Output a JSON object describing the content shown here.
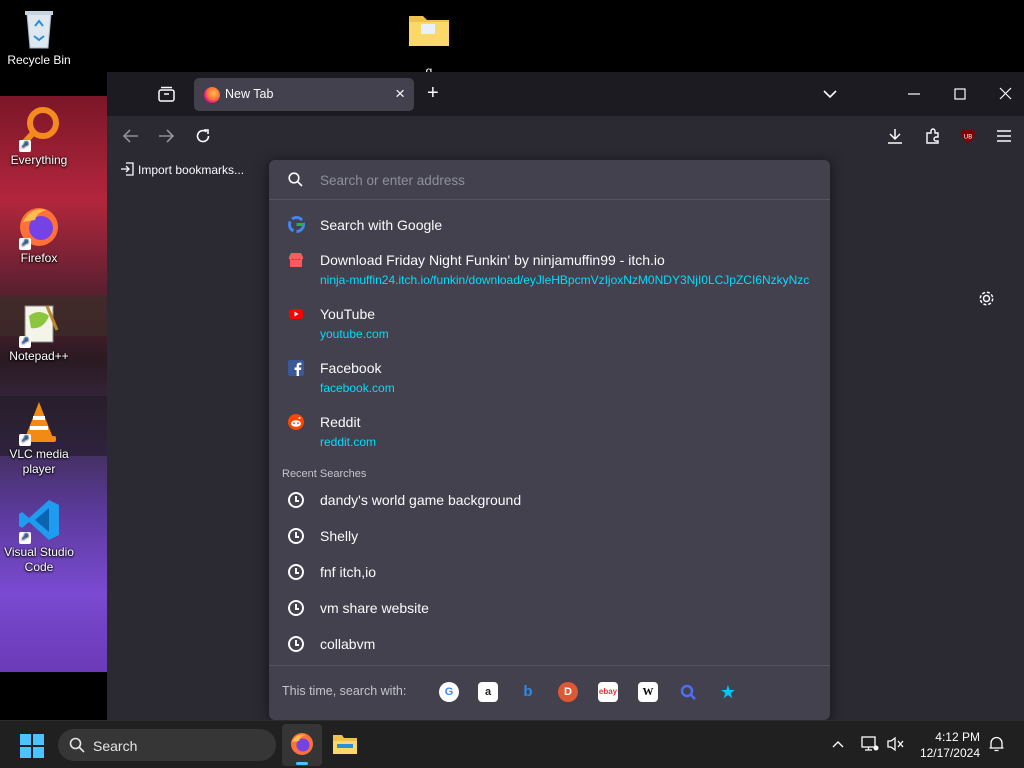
{
  "desktop": {
    "icons": [
      {
        "label": "Recycle Bin"
      },
      {
        "label": "g"
      },
      {
        "label": "Everything"
      },
      {
        "label": "Firefox"
      },
      {
        "label": "Notepad++"
      },
      {
        "label": "VLC media player"
      },
      {
        "label": "Visual Studio Code"
      }
    ]
  },
  "browser": {
    "tab_title": "New Tab",
    "bookmark_import": "Import bookmarks...",
    "address_placeholder": "Search or enter address"
  },
  "suggestions": [
    {
      "title": "Search with Google",
      "url": "",
      "icon": "google-icon"
    },
    {
      "title": "Download Friday Night Funkin' by ninjamuffin99 - itch.io",
      "url": "ninja-muffin24.itch.io/funkin/download/eyJleHBpcmVzIjoxNzM0NDY3NjI0LCJpZCI6NzkyNzc",
      "icon": "itch-icon"
    },
    {
      "title": "YouTube",
      "url": "youtube.com",
      "icon": "youtube-icon"
    },
    {
      "title": "Facebook",
      "url": "facebook.com",
      "icon": "facebook-icon"
    },
    {
      "title": "Reddit",
      "url": "reddit.com",
      "icon": "reddit-icon"
    }
  ],
  "recent": {
    "header": "Recent Searches",
    "items": [
      "dandy's world game background",
      "Shelly",
      "fnf itch,io",
      "vm share website",
      "collabvm"
    ]
  },
  "footer": {
    "label": "This time, search with:",
    "engines": [
      "google",
      "amazon",
      "bing",
      "duckduckgo",
      "ebay",
      "wikipedia",
      "search",
      "bookmarks"
    ]
  },
  "taskbar": {
    "search_label": "Search",
    "time": "4:12 PM",
    "date": "12/17/2024"
  },
  "colors": {
    "panel": "#42414d",
    "link": "#00ddff",
    "toolbar": "#2b2a33"
  }
}
